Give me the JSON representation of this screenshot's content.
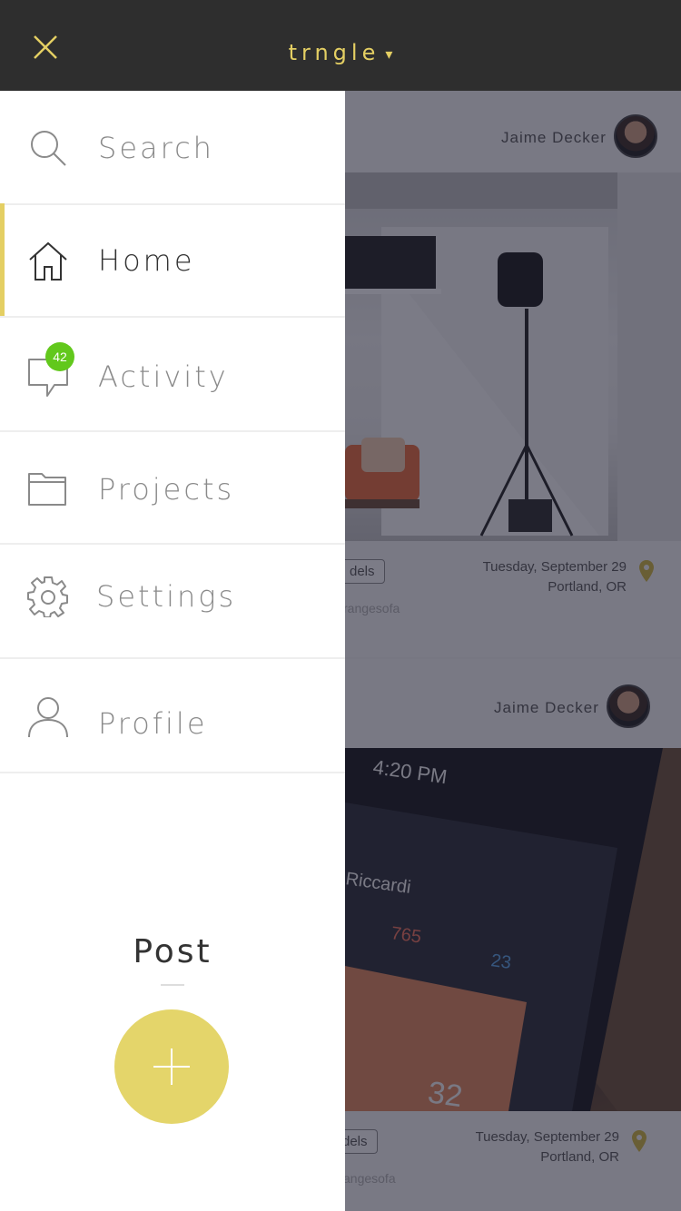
{
  "header": {
    "brand": "trngle",
    "caret": "▾",
    "close_icon": "close-icon"
  },
  "menu": {
    "items": [
      {
        "label": "Search",
        "icon": "search-icon"
      },
      {
        "label": "Home",
        "icon": "home-icon",
        "active": true
      },
      {
        "label": "Activity",
        "icon": "chat-bubble-icon",
        "badge": "42"
      },
      {
        "label": "Projects",
        "icon": "folder-icon"
      },
      {
        "label": "Settings",
        "icon": "gear-icon"
      },
      {
        "label": "Profile",
        "icon": "user-icon"
      }
    ]
  },
  "post": {
    "label": "Post",
    "button_icon": "plus-icon"
  },
  "feed": {
    "cards": [
      {
        "author": "Jaime Decker",
        "tag": "dels",
        "handle": "rangesofa",
        "date": "Tuesday, September 29",
        "location": "Portland, OR"
      },
      {
        "author": "Jaime Decker",
        "tag": "dels",
        "handle": "angesofa",
        "date": "Tuesday, September 29",
        "location": "Portland, OR"
      }
    ]
  },
  "colors": {
    "accent": "#e4cf63",
    "badge": "#62c81c",
    "topbar": "#2e2e2e",
    "post_button": "#e4d56a"
  }
}
